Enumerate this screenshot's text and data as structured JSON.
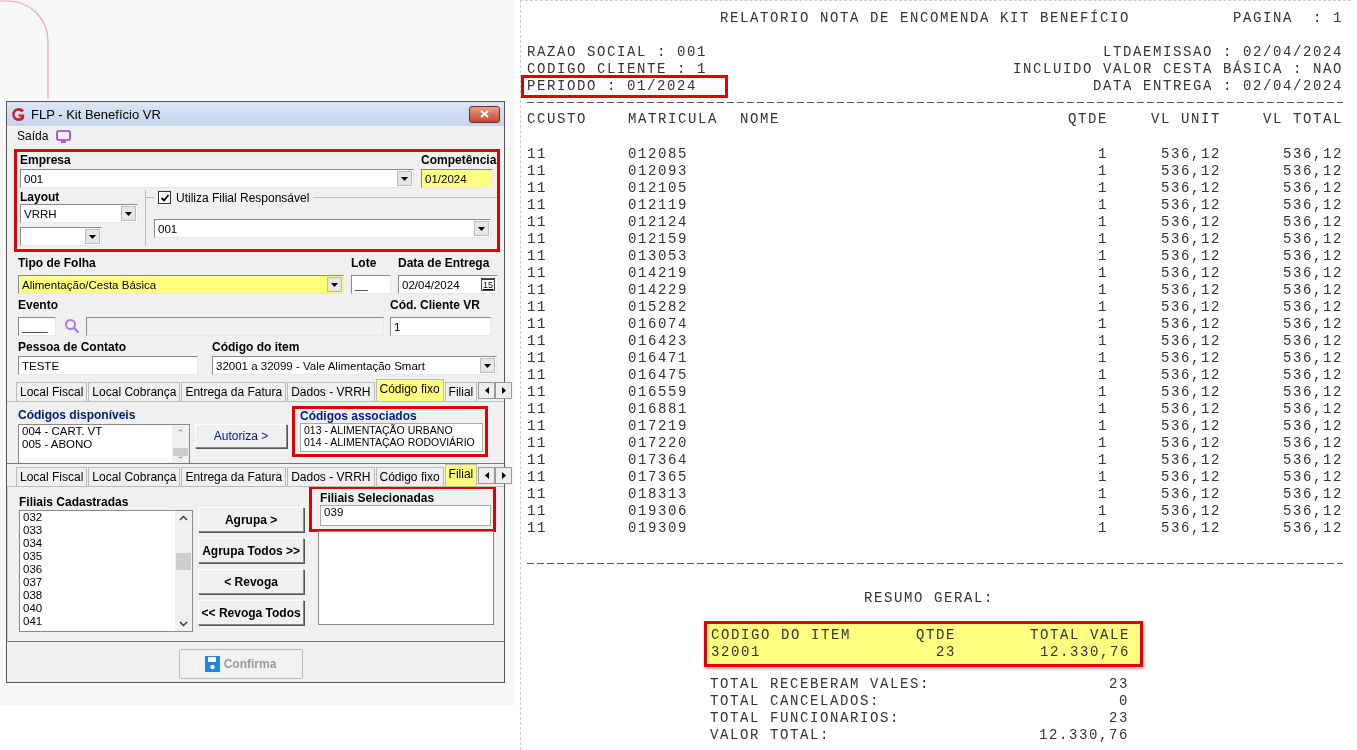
{
  "dialog": {
    "title": "FLP - Kit Benefício VR",
    "menu": [
      "Saída"
    ],
    "empresa": {
      "label": "Empresa",
      "value": "001"
    },
    "competencia": {
      "label": "Competência",
      "value": "01/2024"
    },
    "layout": {
      "label": "Layout",
      "value": "VRRH"
    },
    "filial_responsavel": {
      "label": "Utiliza Filial Responsável",
      "checked": true,
      "value": "001"
    },
    "tipo_folha": {
      "label": "Tipo de Folha",
      "value": "Alimentação/Cesta Básica"
    },
    "lote": {
      "label": "Lote",
      "value": "__"
    },
    "data_entrega": {
      "label": "Data de Entrega",
      "value": "02/04/2024",
      "calendar_day": "15"
    },
    "evento": {
      "label": "Evento",
      "value": "____"
    },
    "cod_cliente": {
      "label": "Cód. Cliente VR",
      "value": "1"
    },
    "pessoa_contato": {
      "label": "Pessoa de Contato",
      "value": "TESTE"
    },
    "codigo_item": {
      "label": "Código do item",
      "value": "32001 a 32099 - Vale Alimentação Smart"
    },
    "tabs_upper": [
      {
        "label": "Local Fiscal",
        "selected": false
      },
      {
        "label": "Local Cobrança",
        "selected": false
      },
      {
        "label": "Entrega da Fatura",
        "selected": false
      },
      {
        "label": "Dados - VRRH",
        "selected": false
      },
      {
        "label": "Código fixo",
        "selected": true
      },
      {
        "label": "Filial",
        "selected": false
      }
    ],
    "codigos_disponiveis": {
      "title": "Códigos disponíveis",
      "items": [
        "004 - CART. VT",
        "005 - ABONO"
      ]
    },
    "autoriza_button": "Autoriza >",
    "codigos_associados": {
      "title": "Códigos associados",
      "items": [
        "013 - ALIMENTAÇÃO URBANO",
        "014 - ALIMENTAÇAO RODOVIÁRIO"
      ]
    },
    "tabs_lower": [
      {
        "label": "Local Fiscal",
        "selected": false
      },
      {
        "label": "Local Cobrança",
        "selected": false
      },
      {
        "label": "Entrega da Fatura",
        "selected": false
      },
      {
        "label": "Dados - VRRH",
        "selected": false
      },
      {
        "label": "Código fixo",
        "selected": false
      },
      {
        "label": "Filial",
        "selected": true
      }
    ],
    "filiais_cadastradas": {
      "title": "Filiais Cadastradas",
      "items": [
        "032",
        "033",
        "034",
        "035",
        "036",
        "037",
        "038",
        "040",
        "041"
      ]
    },
    "actions": [
      "Agrupa >",
      "Agrupa Todos >>",
      "< Revoga",
      "<< Revoga Todos"
    ],
    "filiais_selecionadas": {
      "title": "Filiais Selecionadas",
      "items": [
        "039"
      ]
    },
    "confirm_button": {
      "label": "Confirma",
      "disabled": true
    }
  },
  "report": {
    "title": "RELATORIO NOTA DE ENCOMENDA KIT BENEFÍCIO",
    "page": "PAGINA  : 1",
    "header_left": [
      "RAZAO SOCIAL : 001",
      "CODIGO CLIENTE : 1",
      "PERIODO : 01/2024"
    ],
    "header_right": [
      "LTDAEMISSAO : 02/04/2024",
      "INCLUIDO VALOR CESTA BÁSICA : NAO",
      "DATA ENTREGA : 02/04/2024"
    ],
    "columns": [
      "CCUSTO",
      "MATRICULA",
      "NOME",
      "QTDE",
      "VL UNIT",
      "VL TOTAL"
    ],
    "rows": [
      {
        "ccusto": "11",
        "matricula": "012085",
        "qtde": "1",
        "vl_unit": "536,12",
        "vl_total": "536,12"
      },
      {
        "ccusto": "11",
        "matricula": "012093",
        "qtde": "1",
        "vl_unit": "536,12",
        "vl_total": "536,12"
      },
      {
        "ccusto": "11",
        "matricula": "012105",
        "qtde": "1",
        "vl_unit": "536,12",
        "vl_total": "536,12"
      },
      {
        "ccusto": "11",
        "matricula": "012119",
        "qtde": "1",
        "vl_unit": "536,12",
        "vl_total": "536,12"
      },
      {
        "ccusto": "11",
        "matricula": "012124",
        "qtde": "1",
        "vl_unit": "536,12",
        "vl_total": "536,12"
      },
      {
        "ccusto": "11",
        "matricula": "012159",
        "qtde": "1",
        "vl_unit": "536,12",
        "vl_total": "536,12"
      },
      {
        "ccusto": "11",
        "matricula": "013053",
        "qtde": "1",
        "vl_unit": "536,12",
        "vl_total": "536,12"
      },
      {
        "ccusto": "11",
        "matricula": "014219",
        "qtde": "1",
        "vl_unit": "536,12",
        "vl_total": "536,12"
      },
      {
        "ccusto": "11",
        "matricula": "014229",
        "qtde": "1",
        "vl_unit": "536,12",
        "vl_total": "536,12"
      },
      {
        "ccusto": "11",
        "matricula": "015282",
        "qtde": "1",
        "vl_unit": "536,12",
        "vl_total": "536,12"
      },
      {
        "ccusto": "11",
        "matricula": "016074",
        "qtde": "1",
        "vl_unit": "536,12",
        "vl_total": "536,12"
      },
      {
        "ccusto": "11",
        "matricula": "016423",
        "qtde": "1",
        "vl_unit": "536,12",
        "vl_total": "536,12"
      },
      {
        "ccusto": "11",
        "matricula": "016471",
        "qtde": "1",
        "vl_unit": "536,12",
        "vl_total": "536,12"
      },
      {
        "ccusto": "11",
        "matricula": "016475",
        "qtde": "1",
        "vl_unit": "536,12",
        "vl_total": "536,12"
      },
      {
        "ccusto": "11",
        "matricula": "016559",
        "qtde": "1",
        "vl_unit": "536,12",
        "vl_total": "536,12"
      },
      {
        "ccusto": "11",
        "matricula": "016881",
        "qtde": "1",
        "vl_unit": "536,12",
        "vl_total": "536,12"
      },
      {
        "ccusto": "11",
        "matricula": "017219",
        "qtde": "1",
        "vl_unit": "536,12",
        "vl_total": "536,12"
      },
      {
        "ccusto": "11",
        "matricula": "017220",
        "qtde": "1",
        "vl_unit": "536,12",
        "vl_total": "536,12"
      },
      {
        "ccusto": "11",
        "matricula": "017364",
        "qtde": "1",
        "vl_unit": "536,12",
        "vl_total": "536,12"
      },
      {
        "ccusto": "11",
        "matricula": "017365",
        "qtde": "1",
        "vl_unit": "536,12",
        "vl_total": "536,12"
      },
      {
        "ccusto": "11",
        "matricula": "018313",
        "qtde": "1",
        "vl_unit": "536,12",
        "vl_total": "536,12"
      },
      {
        "ccusto": "11",
        "matricula": "019306",
        "qtde": "1",
        "vl_unit": "536,12",
        "vl_total": "536,12"
      },
      {
        "ccusto": "11",
        "matricula": "019309",
        "qtde": "1",
        "vl_unit": "536,12",
        "vl_total": "536,12"
      }
    ],
    "summary_title": "RESUMO GERAL:",
    "summary": {
      "columns": [
        "CODIGO DO ITEM",
        "QTDE",
        "TOTAL VALE"
      ],
      "row": [
        "32001",
        "23",
        "12.330,76"
      ]
    },
    "totals": [
      {
        "label": "TOTAL RECEBERAM VALES:",
        "value": "23"
      },
      {
        "label": "TOTAL CANCELADOS:",
        "value": "0"
      },
      {
        "label": "TOTAL FUNCIONARIOS:",
        "value": "23"
      },
      {
        "label": "VALOR TOTAL:",
        "value": "12.330,76"
      }
    ]
  }
}
